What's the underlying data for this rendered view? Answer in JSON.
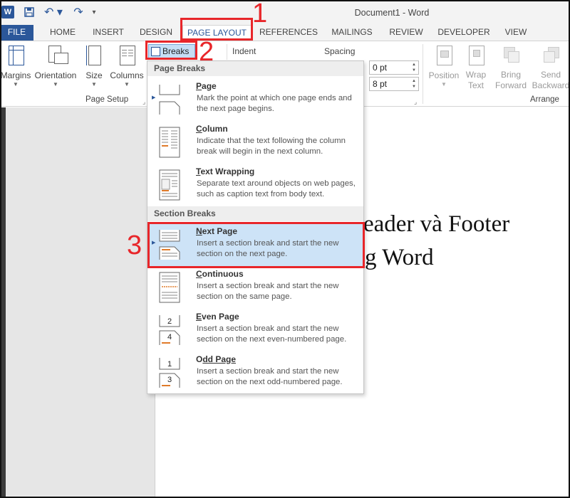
{
  "window": {
    "title": "Document1 - Word",
    "app_icon": "W"
  },
  "quick_access": {
    "undo_glyph": "↶ ▾",
    "redo_glyph": "↷",
    "customize_glyph": "▾"
  },
  "tabs": [
    {
      "label": "FILE"
    },
    {
      "label": "HOME"
    },
    {
      "label": "INSERT"
    },
    {
      "label": "DESIGN"
    },
    {
      "label": "PAGE LAYOUT"
    },
    {
      "label": "REFERENCES"
    },
    {
      "label": "MAILINGS"
    },
    {
      "label": "REVIEW"
    },
    {
      "label": "DEVELOPER"
    },
    {
      "label": "VIEW"
    }
  ],
  "ribbon": {
    "page_setup": {
      "margins": "Margins",
      "orientation": "Orientation",
      "size": "Size",
      "columns": "Columns",
      "breaks": "Breaks",
      "group_label": "Page Setup"
    },
    "paragraph": {
      "indent_label": "Indent",
      "spacing_label": "Spacing",
      "spacing_before": "0 pt",
      "spacing_after": "8 pt"
    },
    "arrange": {
      "position": "Position",
      "wrap_text": [
        "Wrap",
        "Text"
      ],
      "bring_forward": [
        "Bring",
        "Forward"
      ],
      "send_backward": [
        "Send",
        "Backward"
      ],
      "group_label": "Arrange"
    }
  },
  "breaks_menu": {
    "page_breaks_header": "Page Breaks",
    "section_breaks_header": "Section Breaks",
    "items": [
      {
        "key": "P",
        "rest": "age",
        "desc": "Mark the point at which one page ends and the next page begins."
      },
      {
        "key": "C",
        "rest": "olumn",
        "desc": "Indicate that the text following the column break will begin in the next column."
      },
      {
        "key": "T",
        "rest": "ext Wrapping",
        "desc": "Separate text around objects on web pages, such as caption text from body text."
      },
      {
        "key": "N",
        "rest": "ext Page",
        "desc": "Insert a section break and start the new section on the next page."
      },
      {
        "key": "C",
        "rest": "ontinuous",
        "desc": "Insert a section break and start the new section on the same page."
      },
      {
        "key": "E",
        "rest": "ven Page",
        "desc": "Insert a section break and start the new section on the next even-numbered page."
      },
      {
        "key": "O",
        "pre": "",
        "rest": "dd Page",
        "desc": "Insert a section break and start the new section on the next odd-numbered page."
      }
    ]
  },
  "document": {
    "line1": "eader và Footer",
    "line2": "g Word"
  },
  "annotations": [
    "1",
    "2",
    "3"
  ],
  "colors": {
    "accent": "#2b579a",
    "highlight": "#cde3f7",
    "annotation": "#e8262a"
  }
}
